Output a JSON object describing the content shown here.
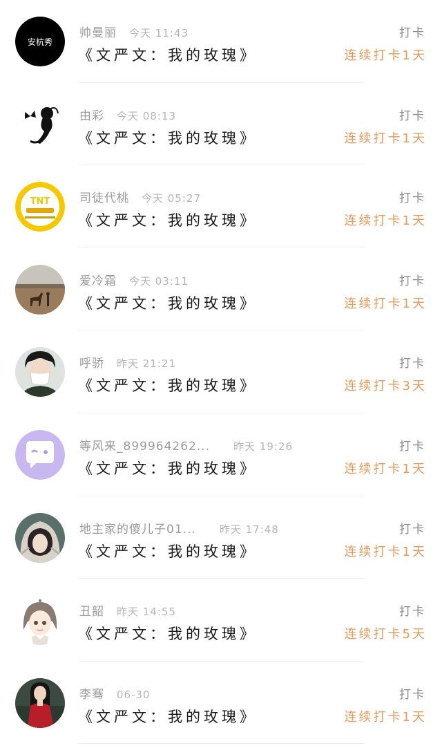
{
  "colors": {
    "accent": "#e69a5c",
    "meta": "#9a9a9a",
    "title": "#1a1a1a",
    "divider": "#f0f0f0"
  },
  "avatar_logo_text": "安杭秀",
  "avatar_badge_text": "TNT",
  "entries": [
    {
      "name": "帅曼丽",
      "time": "今天 11:43",
      "title": "《文严文：我的玫瑰》",
      "action": "打卡",
      "streak": "连续打卡1天",
      "avatar": "black-text-logo"
    },
    {
      "name": "由彩",
      "time": "今天 08:13",
      "title": "《文严文：我的玫瑰》",
      "action": "打卡",
      "streak": "连续打卡1天",
      "avatar": "fairy-silhouette"
    },
    {
      "name": "司徒代桃",
      "time": "今天 05:27",
      "title": "《文严文：我的玫瑰》",
      "action": "打卡",
      "streak": "连续打卡1天",
      "avatar": "yellow-badge"
    },
    {
      "name": "爱冷霜",
      "time": "今天 03:11",
      "title": "《文严文：我的玫瑰》",
      "action": "打卡",
      "streak": "连续打卡1天",
      "avatar": "horse-landscape"
    },
    {
      "name": "呼骄",
      "time": "昨天 21:21",
      "title": "《文严文：我的玫瑰》",
      "action": "打卡",
      "streak": "连续打卡3天",
      "avatar": "masked-person"
    },
    {
      "name": "等风来_899964262...",
      "time": "昨天 19:26",
      "title": "《文严文：我的玫瑰》",
      "action": "打卡",
      "streak": "连续打卡1天",
      "avatar": "purple-chat-bubble"
    },
    {
      "name": "地主家的傻儿子01...",
      "time": "昨天 17:48",
      "title": "《文严文：我的玫瑰》",
      "action": "打卡",
      "streak": "连续打卡1天",
      "avatar": "hooded-person"
    },
    {
      "name": "丑韶",
      "time": "昨天 14:55",
      "title": "《文严文：我的玫瑰》",
      "action": "打卡",
      "streak": "连续打卡5天",
      "avatar": "anime-girl"
    },
    {
      "name": "李骞",
      "time": "06-30",
      "title": "《文严文：我的玫瑰》",
      "action": "打卡",
      "streak": "连续打卡1天",
      "avatar": "woman-red-dress"
    }
  ]
}
